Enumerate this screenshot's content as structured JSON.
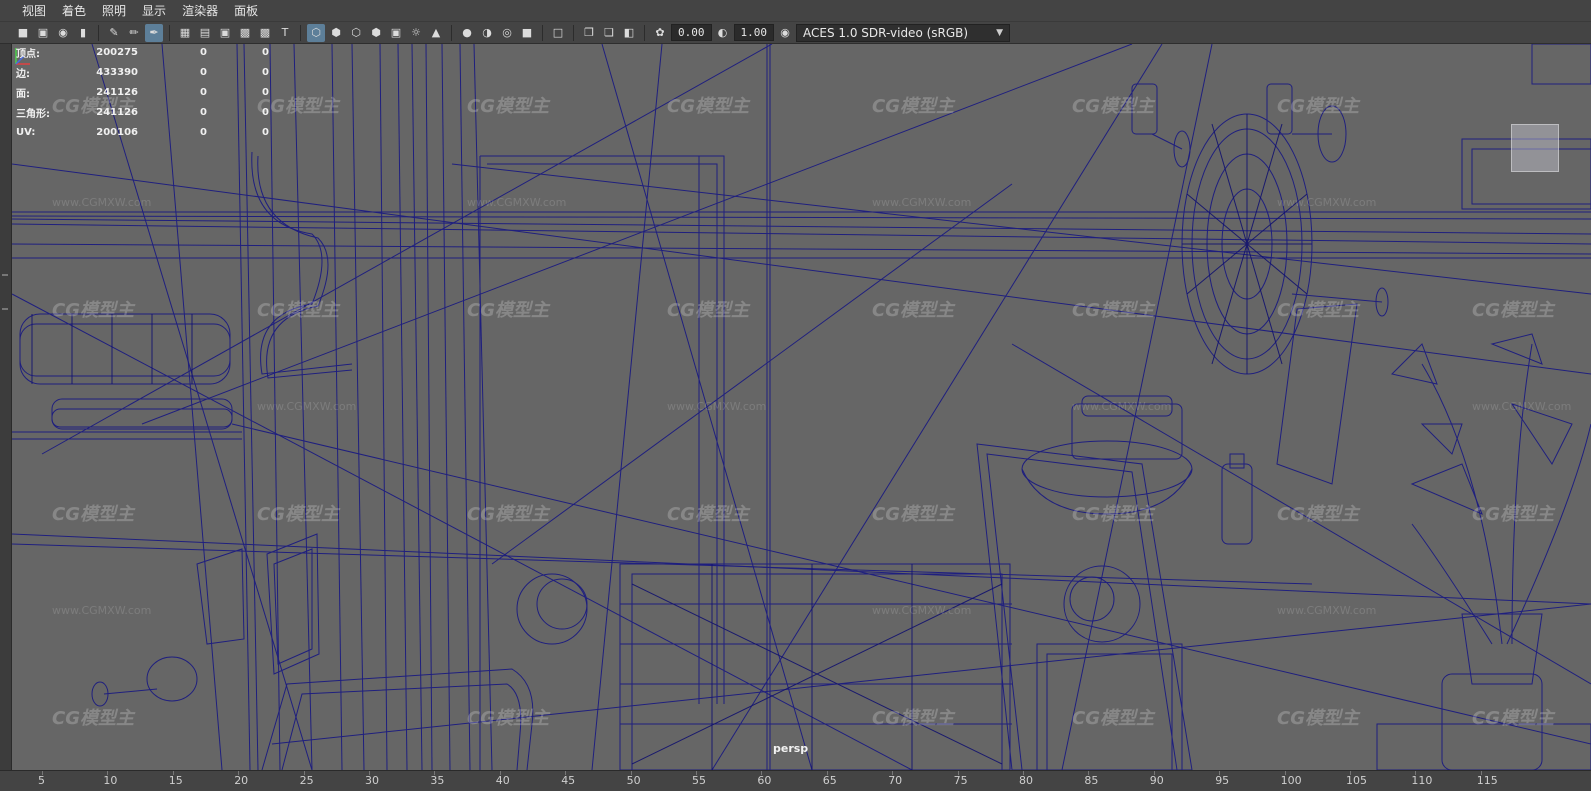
{
  "menubar": {
    "items": [
      "视图",
      "着色",
      "照明",
      "显示",
      "渲染器",
      "面板"
    ]
  },
  "toolbar": {
    "exposure_value": "0.00",
    "gamma_value": "1.00",
    "colorspace": "ACES 1.0 SDR-video (sRGB)",
    "icons": [
      "camera-select-icon",
      "camera-attributes-icon",
      "bookmark-icon",
      "image-plane-icon",
      "grease-pencil-icon",
      "grid-icon",
      "film-gate-icon",
      "resolution-gate-icon",
      "gate-mask-icon",
      "field-chart-icon",
      "safe-action-icon",
      "safe-title-icon",
      "wireframe-icon",
      "smooth-shade-icon",
      "wireframe-on-shaded-icon",
      "textured-icon",
      "use-lights-icon",
      "shadows-icon",
      "ambient-occlusion-icon",
      "motion-blur-icon",
      "anti-aliasing-icon",
      "depth-of-field-icon",
      "isolate-select-icon",
      "xray-icon",
      "xray-joints-icon",
      "xray-components-icon",
      "exposure-icon",
      "gamma-icon",
      "color-management-icon"
    ]
  },
  "hud": {
    "rows": [
      {
        "label": "顶点:",
        "v1": "200275",
        "v2": "0",
        "v3": "0"
      },
      {
        "label": "边:",
        "v1": "433390",
        "v2": "0",
        "v3": "0"
      },
      {
        "label": "面:",
        "v1": "241126",
        "v2": "0",
        "v3": "0"
      },
      {
        "label": "三角形:",
        "v1": "241126",
        "v2": "0",
        "v3": "0"
      },
      {
        "label": "UV:",
        "v1": "200106",
        "v2": "0",
        "v3": "0"
      }
    ]
  },
  "viewport": {
    "camera": "persp",
    "background_color": "#666666",
    "wire_color": "#1a1a7a",
    "watermark_text": "CG模型主",
    "watermark_url": "www.CGMXW.com"
  },
  "time_slider": {
    "ticks": [
      "5",
      "10",
      "15",
      "20",
      "25",
      "30",
      "35",
      "40",
      "45",
      "50",
      "55",
      "60",
      "65",
      "70",
      "75",
      "80",
      "85",
      "90",
      "95",
      "100",
      "105",
      "110",
      "115"
    ]
  }
}
